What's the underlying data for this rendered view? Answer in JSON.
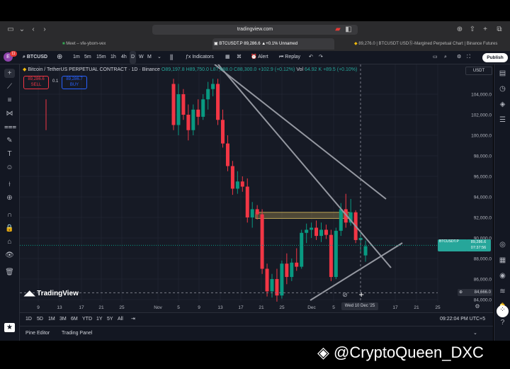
{
  "browser": {
    "url": "tradingview.com",
    "tabs": [
      {
        "label": "Meet – vfe-ybom-vex"
      },
      {
        "label": "BTCUSDT.P 89,286.6 ▲+0.1% Unnamed"
      },
      {
        "label": "89,276.0 | BTCUSDT USDⓈ-Margined Perpetual Chart | Binance Futures"
      }
    ]
  },
  "toolbar": {
    "notif_count": "11",
    "symbol": "BTCUSD",
    "intervals": [
      "1m",
      "5m",
      "15m",
      "1h",
      "4h",
      "D",
      "W",
      "M"
    ],
    "active_interval": "D",
    "indicators_label": "Indicators",
    "alert_label": "Alert",
    "replay_label": "Replay",
    "publish_label": "Publish"
  },
  "chart": {
    "instrument_title": "Bitcoin / TetherUS PERPETUAL CONTRACT · 1D · Binance",
    "ohlc": {
      "o": "O89,197.8",
      "h": "H89,750.0",
      "l": "L87,688.0",
      "c": "C88,300.0",
      "change": "+102.9 (+0.12%)"
    },
    "volume": {
      "label": "Vol",
      "value": "64.92 K",
      "change": "+89.5 (+0.10%)"
    },
    "sell": {
      "price": "89,286.6",
      "label": "SELL"
    },
    "spread": "0.1",
    "buy": {
      "price": "89,286.7",
      "label": "BUY"
    },
    "currency": "USDT",
    "logo_text": "TradingView",
    "price_labels": [
      "104,000.0",
      "102,000.0",
      "100,000.0",
      "98,000.0",
      "96,000.0",
      "94,000.0",
      "92,000.0",
      "90,000.0",
      "88,000.0",
      "86,000.0",
      "84,000.0"
    ],
    "current_price_label": {
      "symbol": "BTCUSDT.P",
      "price": "89,286.6",
      "countdown": "07:37:56"
    },
    "crosshair_price": "84,666.0",
    "time_labels": [
      "9",
      "13",
      "17",
      "21",
      "25",
      "Nov",
      "5",
      "9",
      "13",
      "17",
      "21",
      "25",
      "Dec",
      "5",
      "17",
      "21",
      "25"
    ],
    "crosshair_date": "Wed 10 Dec '25"
  },
  "chart_data": {
    "type": "candlestick",
    "ylim": [
      84000,
      105500
    ],
    "x_axis_ticks": [
      "9",
      "13",
      "17",
      "21",
      "25",
      "Nov",
      "5",
      "9",
      "13",
      "17",
      "21",
      "25",
      "Dec",
      "5",
      "17",
      "21",
      "25"
    ],
    "candles": [
      {
        "o": 105000,
        "h": 105500,
        "l": 100500,
        "c": 101000,
        "dir": "down"
      },
      {
        "o": 101000,
        "h": 105000,
        "l": 100000,
        "c": 104000,
        "dir": "up"
      },
      {
        "o": 104000,
        "h": 104500,
        "l": 101500,
        "c": 102000,
        "dir": "down"
      },
      {
        "o": 102000,
        "h": 103000,
        "l": 99500,
        "c": 100500,
        "dir": "down"
      },
      {
        "o": 100500,
        "h": 103000,
        "l": 100000,
        "c": 102500,
        "dir": "up"
      },
      {
        "o": 102500,
        "h": 103500,
        "l": 101000,
        "c": 101800,
        "dir": "down"
      },
      {
        "o": 101800,
        "h": 104000,
        "l": 101500,
        "c": 103500,
        "dir": "up"
      },
      {
        "o": 103500,
        "h": 105200,
        "l": 102500,
        "c": 104500,
        "dir": "up"
      },
      {
        "o": 104500,
        "h": 105500,
        "l": 103800,
        "c": 105000,
        "dir": "up"
      },
      {
        "o": 105000,
        "h": 105500,
        "l": 101000,
        "c": 101500,
        "dir": "down"
      },
      {
        "o": 101500,
        "h": 102500,
        "l": 98800,
        "c": 99200,
        "dir": "down"
      },
      {
        "o": 99200,
        "h": 100000,
        "l": 96500,
        "c": 97000,
        "dir": "down"
      },
      {
        "o": 97000,
        "h": 97500,
        "l": 94200,
        "c": 94800,
        "dir": "down"
      },
      {
        "o": 94800,
        "h": 96500,
        "l": 94300,
        "c": 95500,
        "dir": "up"
      },
      {
        "o": 95500,
        "h": 96000,
        "l": 94500,
        "c": 95000,
        "dir": "down"
      },
      {
        "o": 95000,
        "h": 95800,
        "l": 91500,
        "c": 92000,
        "dir": "down"
      },
      {
        "o": 92000,
        "h": 93500,
        "l": 91000,
        "c": 92800,
        "dir": "up"
      },
      {
        "o": 92800,
        "h": 93200,
        "l": 91800,
        "c": 92300,
        "dir": "down"
      },
      {
        "o": 92300,
        "h": 92800,
        "l": 86500,
        "c": 87000,
        "dir": "down"
      },
      {
        "o": 87000,
        "h": 87500,
        "l": 84300,
        "c": 84800,
        "dir": "down"
      },
      {
        "o": 84800,
        "h": 86500,
        "l": 84200,
        "c": 86000,
        "dir": "up"
      },
      {
        "o": 86000,
        "h": 87000,
        "l": 83800,
        "c": 84400,
        "dir": "down"
      },
      {
        "o": 84400,
        "h": 87800,
        "l": 84100,
        "c": 87500,
        "dir": "up"
      },
      {
        "o": 87500,
        "h": 88500,
        "l": 85500,
        "c": 86200,
        "dir": "down"
      },
      {
        "o": 86200,
        "h": 88000,
        "l": 85800,
        "c": 87600,
        "dir": "up"
      },
      {
        "o": 87600,
        "h": 89000,
        "l": 86800,
        "c": 87200,
        "dir": "down"
      },
      {
        "o": 87200,
        "h": 90800,
        "l": 87000,
        "c": 90500,
        "dir": "up"
      },
      {
        "o": 90500,
        "h": 91400,
        "l": 89500,
        "c": 90800,
        "dir": "up"
      },
      {
        "o": 90800,
        "h": 91500,
        "l": 90000,
        "c": 91000,
        "dir": "up"
      },
      {
        "o": 91000,
        "h": 91700,
        "l": 89800,
        "c": 90200,
        "dir": "down"
      },
      {
        "o": 90200,
        "h": 91500,
        "l": 89600,
        "c": 90800,
        "dir": "up"
      },
      {
        "o": 90800,
        "h": 91300,
        "l": 89900,
        "c": 90300,
        "dir": "down"
      },
      {
        "o": 90300,
        "h": 90800,
        "l": 85800,
        "c": 86200,
        "dir": "down"
      },
      {
        "o": 86200,
        "h": 91000,
        "l": 86000,
        "c": 90700,
        "dir": "up"
      },
      {
        "o": 90700,
        "h": 93400,
        "l": 90200,
        "c": 92800,
        "dir": "up"
      },
      {
        "o": 92800,
        "h": 94300,
        "l": 91000,
        "c": 91500,
        "dir": "down"
      },
      {
        "o": 91500,
        "h": 93800,
        "l": 91200,
        "c": 92500,
        "dir": "up"
      },
      {
        "o": 92500,
        "h": 92700,
        "l": 89500,
        "c": 89800,
        "dir": "down"
      },
      {
        "o": 89800,
        "h": 90500,
        "l": 88500,
        "c": 90000,
        "dir": "up"
      },
      {
        "o": 89197.8,
        "h": 89750,
        "l": 87688,
        "c": 88300,
        "dir": "up"
      }
    ],
    "zones": [
      {
        "from": 91900,
        "to": 92500,
        "color": "#b8a055"
      }
    ],
    "trendlines": [
      {
        "from": [
          "start",
          106000
        ],
        "to": [
          "Dec 5",
          94500
        ]
      },
      {
        "from": [
          "Oct 29",
          105500
        ],
        "to": [
          "Dec 20",
          88500
        ]
      },
      {
        "from": [
          "Dec 1",
          84000
        ],
        "to": [
          "Dec 25",
          90000
        ]
      }
    ],
    "last_price": 89286.6
  }
}
